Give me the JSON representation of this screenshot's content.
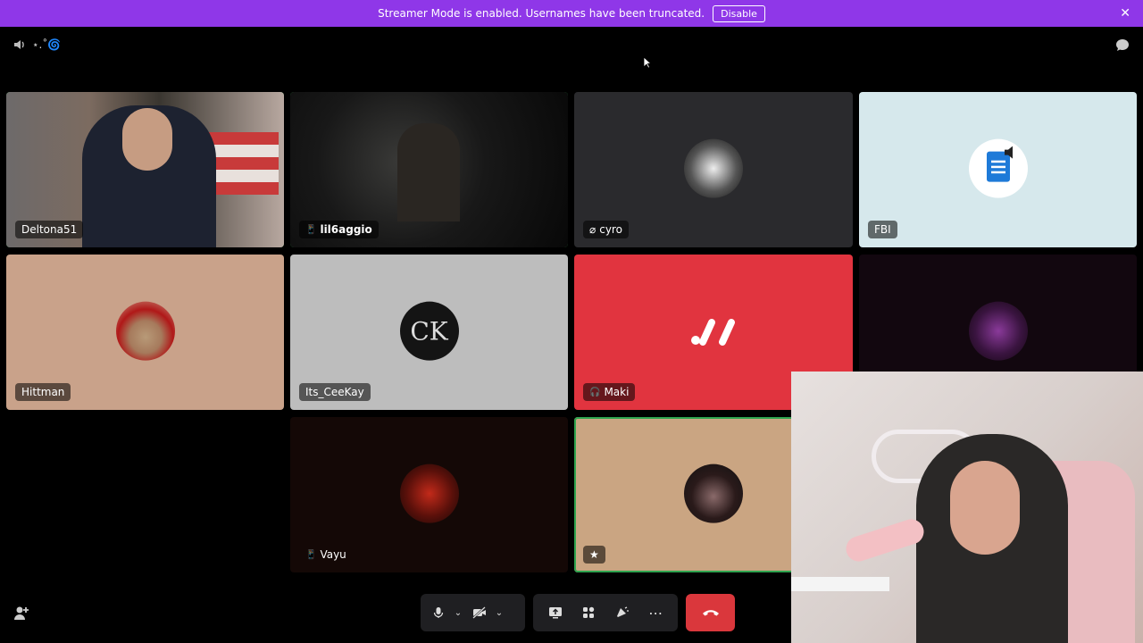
{
  "banner": {
    "message": "Streamer Mode is enabled. Usernames have been truncated.",
    "disable_label": "Disable",
    "close_glyph": "✕"
  },
  "header": {
    "channel_name": "⋆.˚🌀",
    "volume_icon": "speaker-icon",
    "chat_icon": "chat-bubble-icon"
  },
  "tiles": [
    {
      "name": "Deltona51",
      "prefix_icon": "",
      "bg": "#4a4038",
      "speaking": true,
      "kind": "camera"
    },
    {
      "name": "lil6aggio",
      "prefix_icon": "📱",
      "bg": "#151515",
      "speaking": true,
      "kind": "camera"
    },
    {
      "name": "cyro",
      "prefix_icon": "⌀",
      "bg": "#2a2a2d",
      "speaking": false,
      "kind": "avatar"
    },
    {
      "name": "FBI",
      "prefix_icon": "",
      "bg": "#d6e8ec",
      "speaking": false,
      "kind": "avatar"
    },
    {
      "name": "Hittman",
      "prefix_icon": "",
      "bg": "#c9a28a",
      "speaking": false,
      "kind": "avatar"
    },
    {
      "name": "Its_CeeKay",
      "prefix_icon": "",
      "bg": "#bdbdbd",
      "speaking": false,
      "kind": "avatar"
    },
    {
      "name": "Maki",
      "prefix_icon": "🎧",
      "bg": "#e1343f",
      "speaking": false,
      "kind": "avatar"
    },
    {
      "name": "",
      "prefix_icon": "",
      "bg": "#12070f",
      "speaking": false,
      "kind": "avatar"
    },
    {
      "name": "Vayu",
      "prefix_icon": "📱",
      "bg": "#140806",
      "speaking": false,
      "kind": "avatar"
    },
    {
      "name": "",
      "prefix_icon": "★",
      "bg": "#caa582",
      "speaking": true,
      "kind": "avatar"
    }
  ],
  "controls": {
    "mic_icon": "microphone-icon",
    "camera_icon": "camera-off-icon",
    "screenshare_icon": "screen-share-icon",
    "activities_icon": "activities-icon",
    "soundboard_icon": "soundboard-icon",
    "more_glyph": "⋯",
    "hangup_icon": "phone-hangup-icon",
    "invite_icon": "add-user-icon"
  },
  "colors": {
    "banner": "#8f37e8",
    "speaking": "#2fa44f",
    "hangup": "#da373c"
  }
}
